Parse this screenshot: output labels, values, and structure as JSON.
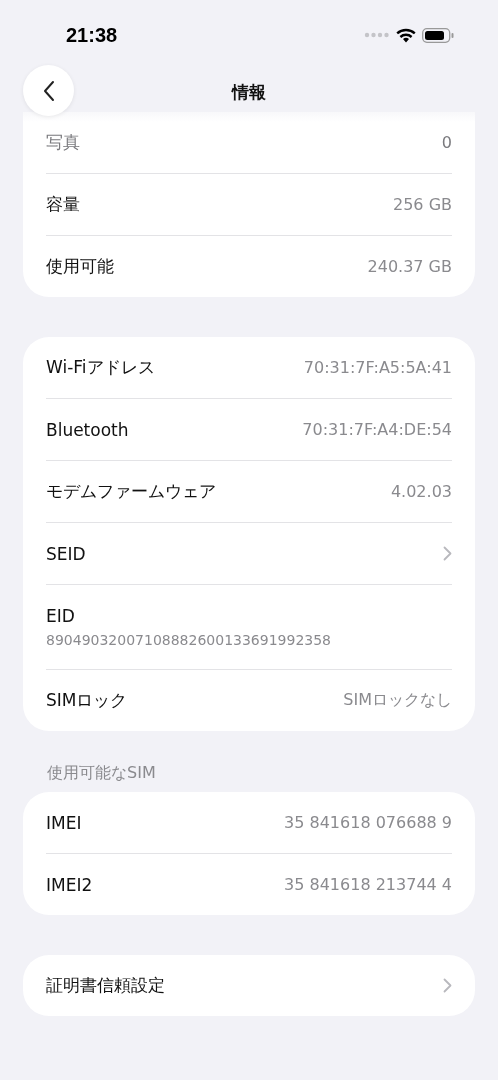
{
  "status_bar": {
    "time": "21:38"
  },
  "nav": {
    "title": "情報"
  },
  "groups": [
    {
      "rows": [
        {
          "kind": "value",
          "label": "写真",
          "value": "0",
          "faded": true
        },
        {
          "kind": "value",
          "label": "容量",
          "value": "256 GB",
          "faded": false
        },
        {
          "kind": "value",
          "label": "使用可能",
          "value": "240.37 GB",
          "faded": false
        }
      ]
    },
    {
      "rows": [
        {
          "kind": "value",
          "label": "Wi-Fiアドレス",
          "value": "70:31:7F:A5:5A:41",
          "faded": false
        },
        {
          "kind": "value",
          "label": "Bluetooth",
          "value": "70:31:7F:A4:DE:54",
          "faded": false
        },
        {
          "kind": "value",
          "label": "モデムファームウェア",
          "value": "4.02.03",
          "faded": false
        },
        {
          "kind": "link",
          "label": "SEID",
          "faded": false
        },
        {
          "kind": "stacked",
          "label": "EID",
          "value": "89049032007108882600133691992358",
          "faded": false
        },
        {
          "kind": "value",
          "label": "SIMロック",
          "value": "SIMロックなし",
          "faded": false
        }
      ]
    },
    {
      "header": "使用可能なSIM",
      "rows": [
        {
          "kind": "value",
          "label": "IMEI",
          "value": "35 841618 076688 9",
          "faded": false
        },
        {
          "kind": "value",
          "label": "IMEI2",
          "value": "35 841618 213744 4",
          "faded": false
        }
      ]
    },
    {
      "rows": [
        {
          "kind": "link",
          "label": "証明書信頼設定",
          "faded": false
        }
      ]
    }
  ]
}
